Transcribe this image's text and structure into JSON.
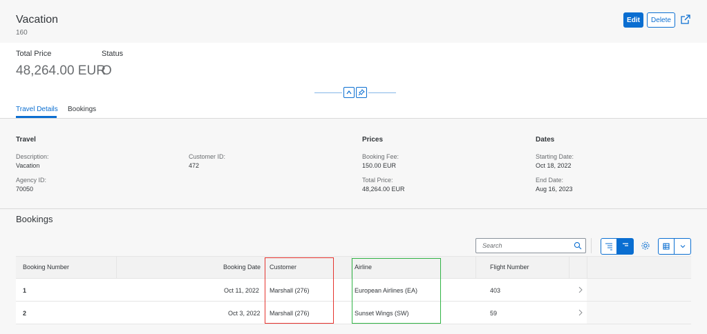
{
  "header": {
    "title": "Vacation",
    "subtitle": "160",
    "edit_label": "Edit",
    "delete_label": "Delete"
  },
  "kpi": {
    "total_price_label": "Total Price",
    "total_price_value": "48,264.00 EUR",
    "status_label": "Status",
    "status_value": "O"
  },
  "tabs": [
    {
      "label": "Travel Details"
    },
    {
      "label": "Bookings"
    }
  ],
  "travel": {
    "title": "Travel",
    "description_label": "Description:",
    "description_value": "Vacation",
    "agency_label": "Agency ID:",
    "agency_value": "70050",
    "customer_label": "Customer ID:",
    "customer_value": "472"
  },
  "prices": {
    "title": "Prices",
    "booking_fee_label": "Booking Fee:",
    "booking_fee_value": "150.00 EUR",
    "total_price_label": "Total Price:",
    "total_price_value": "48,264.00 EUR"
  },
  "dates": {
    "title": "Dates",
    "start_label": "Starting Date:",
    "start_value": "Oct 18, 2022",
    "end_label": "End Date:",
    "end_value": "Aug 16, 2023"
  },
  "bookings": {
    "title": "Bookings",
    "search_placeholder": "Search",
    "columns": [
      "Booking Number",
      "Booking Date",
      "Customer",
      "Airline",
      "Flight Number"
    ],
    "rows": [
      {
        "number": "1",
        "date": "Oct 11, 2022",
        "customer": "Marshall (276)",
        "airline": "European Airlines (EA)",
        "flight": "403"
      },
      {
        "number": "2",
        "date": "Oct 3, 2022",
        "customer": "Marshall (276)",
        "airline": "Sunset Wings (SW)",
        "flight": "59"
      }
    ]
  },
  "colors": {
    "accent": "#0a6ed1",
    "highlight_red": "#e5322d",
    "highlight_green": "#2fb344"
  }
}
